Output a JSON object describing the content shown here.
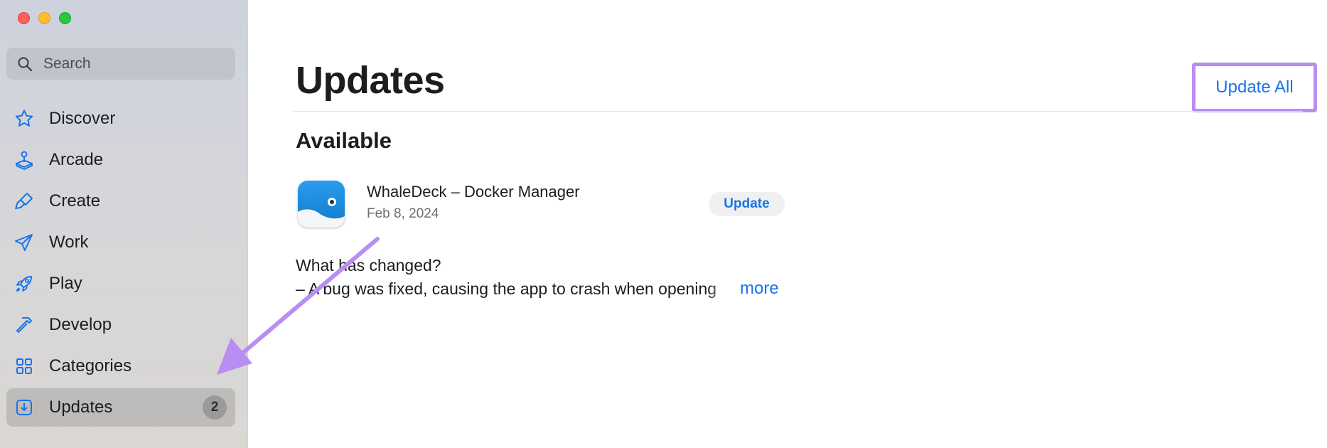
{
  "window": {
    "traffic_lights": [
      "close",
      "minimize",
      "zoom"
    ]
  },
  "search": {
    "placeholder": "Search"
  },
  "sidebar": {
    "items": [
      {
        "label": "Discover",
        "icon": "star-icon"
      },
      {
        "label": "Arcade",
        "icon": "joystick-icon"
      },
      {
        "label": "Create",
        "icon": "brush-icon"
      },
      {
        "label": "Work",
        "icon": "paper-plane-icon"
      },
      {
        "label": "Play",
        "icon": "rocket-icon"
      },
      {
        "label": "Develop",
        "icon": "hammer-icon"
      },
      {
        "label": "Categories",
        "icon": "grid-icon"
      },
      {
        "label": "Updates",
        "icon": "download-icon",
        "badge": "2",
        "active": true
      }
    ]
  },
  "main": {
    "title": "Updates",
    "update_all_label": "Update All",
    "section_title": "Available",
    "app": {
      "name": "WhaleDeck – Docker Manager",
      "date": "Feb 8, 2024",
      "update_label": "Update",
      "changes_heading": "What has changed?",
      "changes_text": "– A bug was fixed, causing the app to crash when opening",
      "more_label": "more"
    }
  },
  "colors": {
    "accent": "#1a73e8",
    "annotation": "#b98ef2",
    "app_icon": "#1d8fe0"
  }
}
